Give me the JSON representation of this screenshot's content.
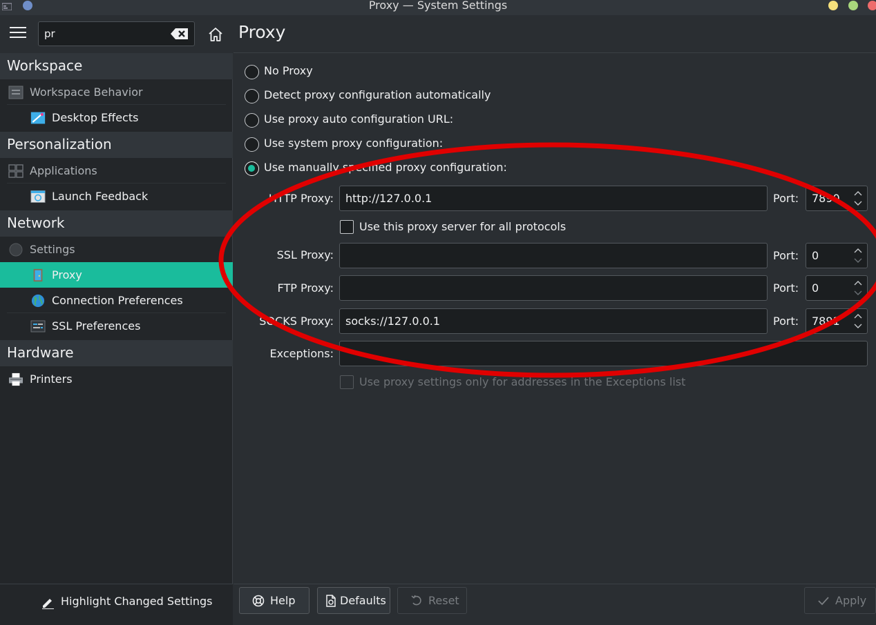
{
  "window": {
    "title": "Proxy — System Settings"
  },
  "sidebar": {
    "search_value": "pr",
    "categories": [
      {
        "title": "Workspace"
      },
      {
        "title": "Personalization"
      },
      {
        "title": "Network"
      },
      {
        "title": "Hardware"
      }
    ],
    "items": [
      {
        "label": "Workspace Behavior",
        "icon": "workspace-behavior-icon"
      },
      {
        "label": "Desktop Effects",
        "icon": "desktop-effects-icon"
      },
      {
        "label": "Applications",
        "icon": "applications-icon"
      },
      {
        "label": "Launch Feedback",
        "icon": "launch-feedback-icon"
      },
      {
        "label": "Settings",
        "icon": "network-settings-icon"
      },
      {
        "label": "Proxy",
        "icon": "proxy-icon",
        "selected": true
      },
      {
        "label": "Connection Preferences",
        "icon": "globe-icon"
      },
      {
        "label": "SSL Preferences",
        "icon": "ssl-preferences-icon"
      },
      {
        "label": "Printers",
        "icon": "printer-icon"
      }
    ],
    "highlight_label": "Highlight Changed Settings"
  },
  "main": {
    "title": "Proxy",
    "radios": [
      {
        "label": "No Proxy",
        "checked": false
      },
      {
        "label": "Detect proxy configuration automatically",
        "checked": false
      },
      {
        "label": "Use proxy auto configuration URL:",
        "checked": false
      },
      {
        "label": "Use system proxy configuration:",
        "checked": false
      },
      {
        "label": "Use manually specified proxy configuration:",
        "checked": true
      }
    ],
    "http": {
      "label": "HTTP Proxy:",
      "value": "http://127.0.0.1",
      "port_label": "Port:",
      "port": "7890"
    },
    "all_protocols_label": "Use this proxy server for all protocols",
    "ssl": {
      "label": "SSL Proxy:",
      "value": "",
      "port_label": "Port:",
      "port": "0"
    },
    "ftp": {
      "label": "FTP Proxy:",
      "value": "",
      "port_label": "Port:",
      "port": "0"
    },
    "socks": {
      "label": "SOCKS Proxy:",
      "value": "socks://127.0.0.1",
      "port_label": "Port:",
      "port": "7891"
    },
    "exceptions": {
      "label": "Exceptions:",
      "value": ""
    },
    "exceptions_only_label": "Use proxy settings only for addresses in the Exceptions list"
  },
  "buttons": {
    "help": "Help",
    "defaults": "Defaults",
    "reset": "Reset",
    "apply": "Apply"
  },
  "colors": {
    "accent": "#1abc9c",
    "annotation": "#e00000"
  }
}
